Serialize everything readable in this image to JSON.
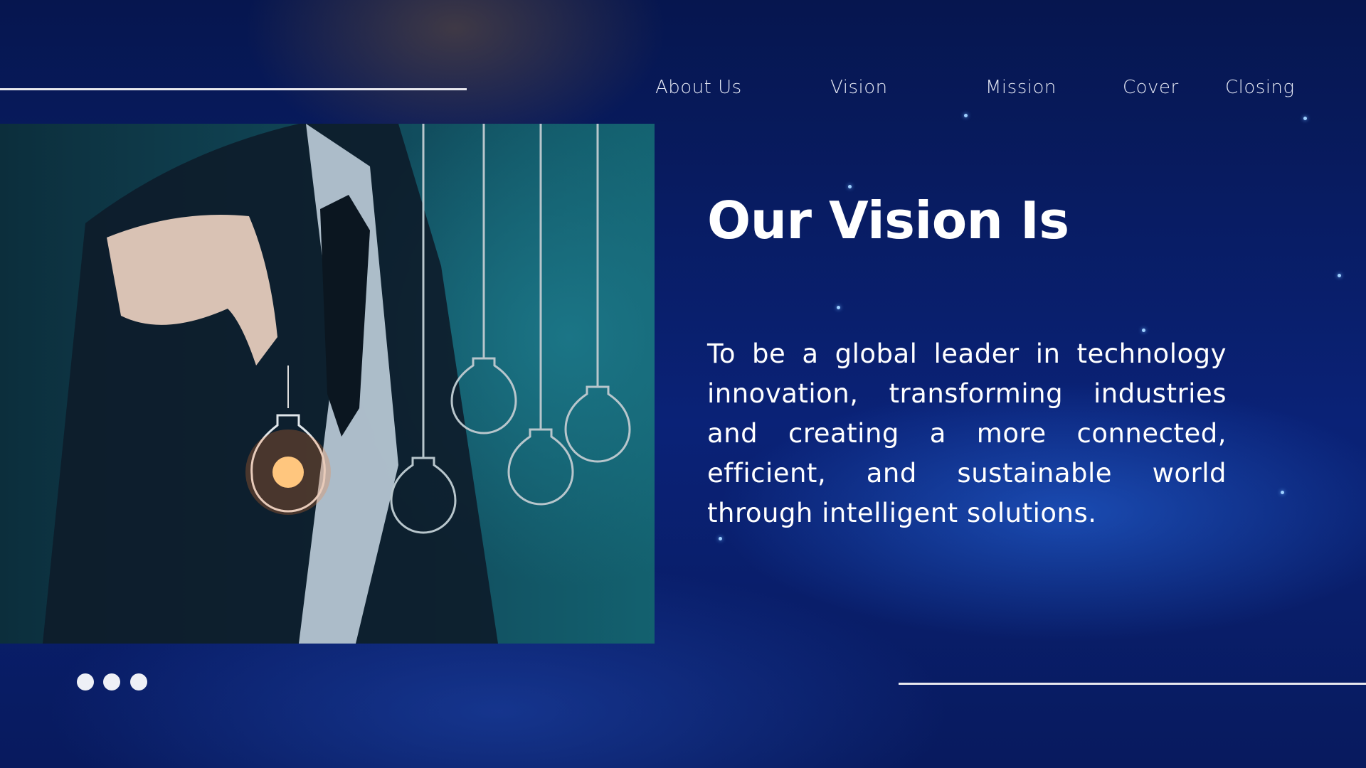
{
  "nav": {
    "items": [
      "About Us",
      "Vision",
      "Mission",
      "Cover",
      "Closing"
    ]
  },
  "main": {
    "title": "Our Vision Is",
    "body": "To be a global leader in technology innovation, transforming industries and creating a more connected, efficient, and sustainable world through intelligent solutions."
  },
  "pagination": {
    "dots": 3
  },
  "colors": {
    "background": "#0a2277",
    "text": "#ffffff",
    "photo_tint": "#114b5c"
  }
}
